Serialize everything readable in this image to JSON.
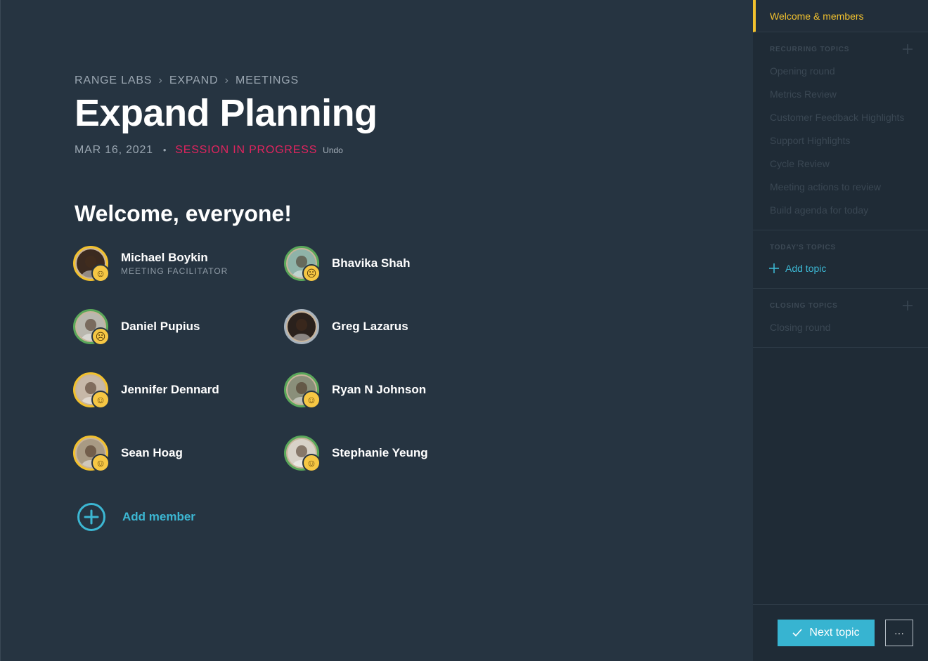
{
  "breadcrumb": [
    "RANGE LABS",
    "EXPAND",
    "MEETINGS"
  ],
  "breadcrumb_separator": "›",
  "title": "Expand Planning",
  "meta": {
    "date": "MAR 16, 2021",
    "dot": "•",
    "status": "SESSION IN PROGRESS",
    "undo": "Undo"
  },
  "welcome": "Welcome, everyone!",
  "members": [
    {
      "name": "Michael Boykin",
      "role": "MEETING FACILITATOR",
      "ring": "yellow",
      "emoji": "☺",
      "photo_tone": "#3b2a20"
    },
    {
      "name": "Bhavika Shah",
      "role": "",
      "ring": "green",
      "emoji": "☹",
      "photo_tone": "#8fb3a8"
    },
    {
      "name": "Daniel Pupius",
      "role": "",
      "ring": "green",
      "emoji": "☹",
      "photo_tone": "#b9b7ae"
    },
    {
      "name": "Greg Lazarus",
      "role": "",
      "ring": "gray",
      "emoji": "",
      "photo_tone": "#2a211c"
    },
    {
      "name": "Jennifer Dennard",
      "role": "",
      "ring": "yellow",
      "emoji": "☺",
      "photo_tone": "#c7b8a8"
    },
    {
      "name": "Ryan N Johnson",
      "role": "",
      "ring": "green",
      "emoji": "☺",
      "photo_tone": "#8a8f7a"
    },
    {
      "name": "Sean Hoag",
      "role": "",
      "ring": "yellow",
      "emoji": "☺",
      "photo_tone": "#a89a84"
    },
    {
      "name": "Stephanie Yeung",
      "role": "",
      "ring": "green",
      "emoji": "☺",
      "photo_tone": "#d8d2c8"
    }
  ],
  "add_member": "Add member",
  "sidebar": {
    "active": "Welcome & members",
    "recurring_heading": "RECURRING TOPICS",
    "recurring": [
      "Opening round",
      "Metrics Review",
      "Customer Feedback Highlights",
      "Support Highlights",
      "Cycle Review",
      "Meeting actions to review",
      "Build agenda for today"
    ],
    "today_heading": "TODAY'S TOPICS",
    "add_topic": "Add topic",
    "closing_heading": "CLOSING TOPICS",
    "closing": [
      "Closing round"
    ]
  },
  "footer": {
    "next_topic": "Next topic",
    "more": "···"
  },
  "colors": {
    "accent": "#3cb7d3",
    "status": "#e0245e",
    "highlight": "#f2c12e"
  },
  "icons": {
    "add_member": "plus-circle-icon",
    "add_topic": "plus-icon",
    "section_add": "plus-icon",
    "next_topic": "check-icon",
    "more": "ellipsis-icon"
  }
}
